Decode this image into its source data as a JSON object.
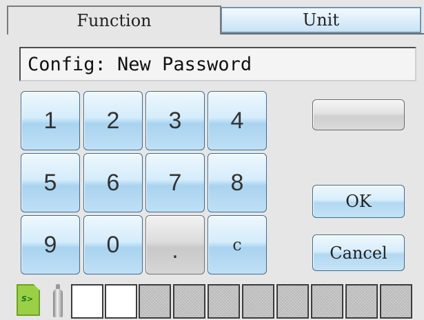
{
  "tabs": [
    {
      "label": "Function",
      "active": true
    },
    {
      "label": "Unit",
      "active": false
    }
  ],
  "display": {
    "text": "Config: New Password"
  },
  "keypad": {
    "keys": [
      "1",
      "2",
      "3",
      "4",
      "5",
      "6",
      "7",
      "8",
      "9",
      "0",
      ".",
      "c"
    ]
  },
  "side_buttons": {
    "blank": "",
    "ok": "OK",
    "cancel": "Cancel"
  },
  "status_bar": {
    "sd_icon": "sd-card-icon",
    "sd_label": "S>",
    "gas_icon": "gas-cylinder-icon",
    "slots": [
      "empty",
      "empty",
      "hatched",
      "hatched",
      "hatched",
      "hatched",
      "hatched",
      "hatched",
      "hatched",
      "hatched"
    ]
  },
  "colors": {
    "key_blue": "#bfe0f6",
    "key_border": "#3e6a8e",
    "key_gray": "#d6d6d6",
    "sd_green": "#9ad046"
  }
}
